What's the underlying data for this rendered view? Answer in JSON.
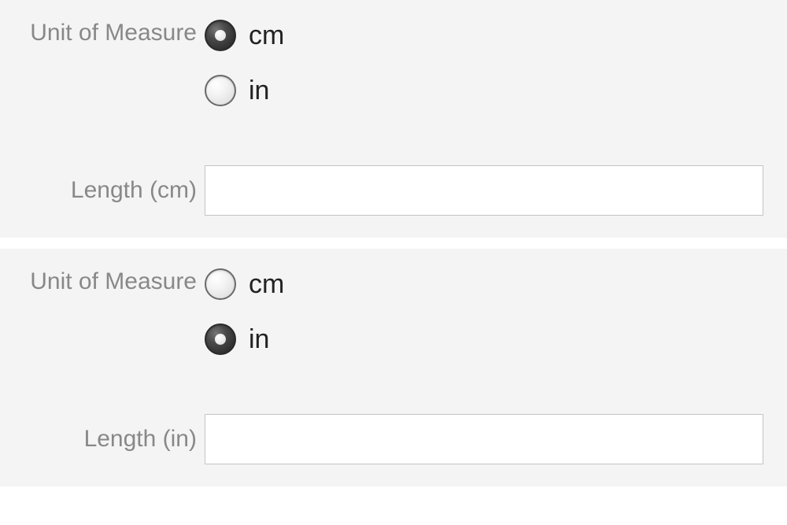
{
  "panels": [
    {
      "unit_label": "Unit of Measure",
      "options": [
        {
          "label": "cm",
          "selected": true
        },
        {
          "label": "in",
          "selected": false
        }
      ],
      "length_label": "Length (cm)",
      "length_value": ""
    },
    {
      "unit_label": "Unit of Measure",
      "options": [
        {
          "label": "cm",
          "selected": false
        },
        {
          "label": "in",
          "selected": true
        }
      ],
      "length_label": "Length (in)",
      "length_value": ""
    }
  ]
}
